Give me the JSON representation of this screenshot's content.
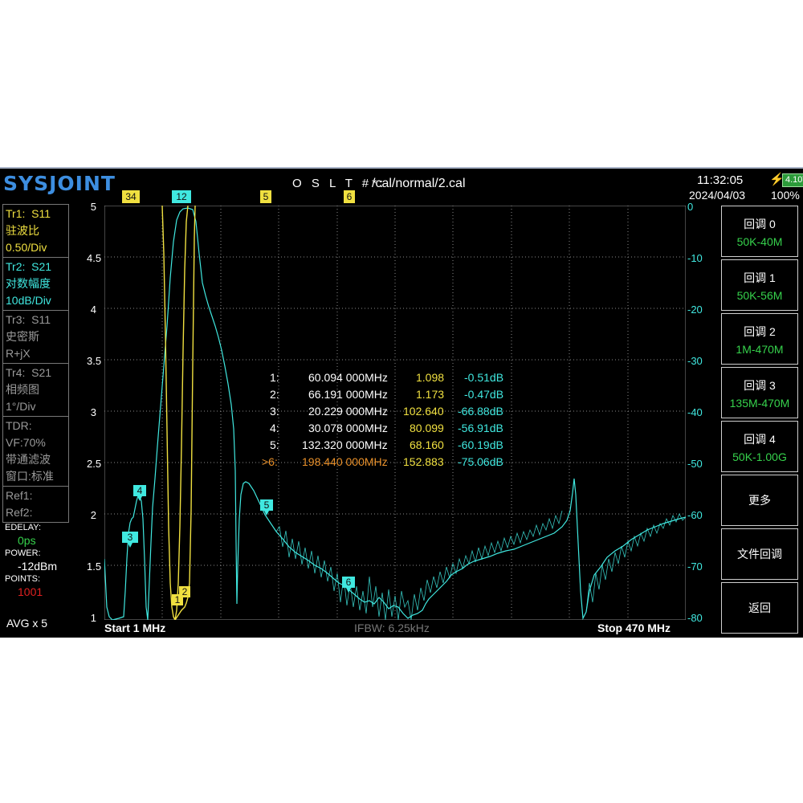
{
  "header": {
    "logo": "SYSJOINT",
    "cal_label": "O S L T #*:",
    "cal_file": "/cal/normal/2.cal",
    "time": "11:32:05",
    "date": "2024/04/03",
    "battery_voltage": "4.10V",
    "battery_percent": "100%"
  },
  "traces": [
    {
      "id": "Tr1:",
      "param": "S11",
      "format": "驻波比",
      "scale": "0.50/Div",
      "color": "#f0e040"
    },
    {
      "id": "Tr2:",
      "param": "S21",
      "format": "对数幅度",
      "scale": "10dB/Div",
      "color": "#40e8e0"
    },
    {
      "id": "Tr3:",
      "param": "S11",
      "format": "史密斯",
      "scale": "R+jX",
      "color": "#9a9a9a"
    },
    {
      "id": "Tr4:",
      "param": "S21",
      "format": "相频图",
      "scale": "1°/Div",
      "color": "#9a9a9a"
    }
  ],
  "tdr": {
    "title": "TDR:",
    "vf": "VF:70%",
    "mode": "带通滤波",
    "window": "窗口:标准"
  },
  "refs": {
    "ref1": "Ref1:",
    "ref2": "Ref2:"
  },
  "settings": {
    "edelay_label": "EDELAY:",
    "edelay_value": "0ps",
    "power_label": "POWER:",
    "power_value": "-12dBm",
    "points_label": "POINTS:",
    "points_value": "1001",
    "avg": "AVG x 5"
  },
  "softkeys": [
    {
      "label": "回调 0",
      "sub": "50K-40M"
    },
    {
      "label": "回调 1",
      "sub": "50K-56M"
    },
    {
      "label": "回调 2",
      "sub": "1M-470M"
    },
    {
      "label": "回调 3",
      "sub": "135M-470M"
    },
    {
      "label": "回调 4",
      "sub": "50K-1.00G"
    },
    {
      "label": "更多",
      "sub": ""
    },
    {
      "label": "文件回调",
      "sub": ""
    },
    {
      "label": "返回",
      "sub": ""
    }
  ],
  "axes": {
    "left_ticks": [
      "5",
      "4.5",
      "4",
      "3.5",
      "3",
      "2.5",
      "2",
      "1.5",
      "1"
    ],
    "right_ticks": [
      "0",
      "-10",
      "-20",
      "-30",
      "-40",
      "-50",
      "-60",
      "-70",
      "-80"
    ]
  },
  "footer": {
    "start": "Start   1 MHz",
    "ifbw": "IFBW: 6.25kHz",
    "stop": "Stop   470 MHz"
  },
  "markers": [
    {
      "num": "1:",
      "freq": "60.094 000MHz",
      "swr": "1.098",
      "db": "-0.51dB",
      "active": false
    },
    {
      "num": "2:",
      "freq": "66.191 000MHz",
      "swr": "1.173",
      "db": "-0.47dB",
      "active": false
    },
    {
      "num": "3:",
      "freq": "20.229 000MHz",
      "swr": "102.640",
      "db": "-66.88dB",
      "active": false
    },
    {
      "num": "4:",
      "freq": "30.078 000MHz",
      "swr": "80.099",
      "db": "-56.91dB",
      "active": false
    },
    {
      "num": "5:",
      "freq": "132.320 000MHz",
      "swr": "68.160",
      "db": "-60.19dB",
      "active": false
    },
    {
      "num": ">6:",
      "freq": "198.440 000MHz",
      "swr": "152.883",
      "db": "-75.06dB",
      "active": true
    }
  ],
  "marker_tags": [
    "3",
    "4",
    "12",
    "5",
    "6",
    "1",
    "2",
    "3",
    "4",
    "5",
    "6"
  ],
  "colors": {
    "swr_trace": "#f0e040",
    "s21_trace": "#40e8e0",
    "active_marker": "#e8902a",
    "grid": "#8a8a8a"
  }
}
